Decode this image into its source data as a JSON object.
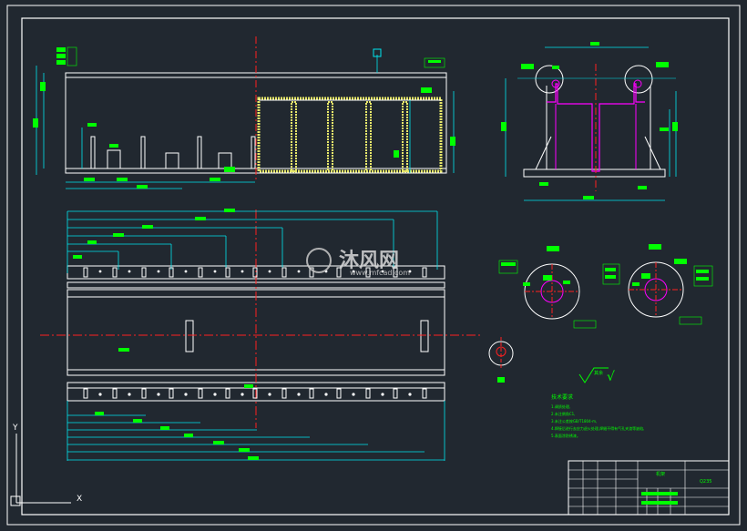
{
  "watermark": {
    "text": "沐风网",
    "subtext": "www.mfcad.com"
  },
  "notes": {
    "title": "技术要求",
    "lines": [
      "1.调质处理,",
      "2.未注倒角C1,",
      "3.未注公差按GB/T1804-m,",
      "4.焊接后进行去应力退火处理,焊缝不得有气孔夹渣等缺陷,",
      "5.表面涂防锈漆。"
    ]
  },
  "surface_finish": {
    "symbol": "√",
    "label": "其余"
  },
  "title_block": {
    "drawing_name": "机架",
    "material": "Q235"
  },
  "ucs": {
    "y_label": "Y",
    "x_label": "X"
  },
  "colors": {
    "background": "#212830",
    "line": "#ffffff",
    "dimension": "#00e5ee",
    "dim_text_bg": "#00ff00",
    "centerline": "#ff2020",
    "hatch": "#e8e86a",
    "magenta": "#ff00ff",
    "annotation": "#00ff00"
  }
}
